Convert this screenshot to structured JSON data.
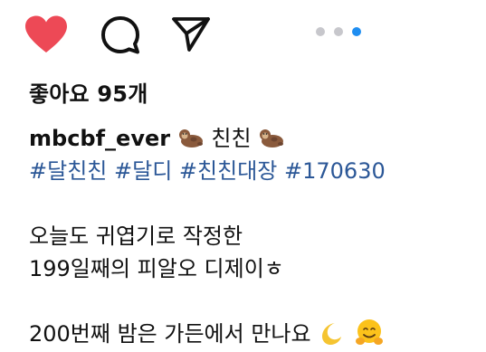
{
  "post": {
    "likes_text": "좋아요 95개",
    "username": "mbcbf_ever",
    "caption_head_text": "친친",
    "hashtags": [
      "#달친친",
      "#달디",
      "#친친대장",
      "#170630"
    ],
    "body_lines": [
      "오늘도 귀엽기로 작정한",
      "199일째의 피알오 디제이ㅎ"
    ],
    "last_line": "200번째 밤은 가든에서 만나요"
  },
  "icons": {
    "like": "heart-filled-icon",
    "comment": "comment-icon",
    "share": "send-icon",
    "carousel": "carousel-dots",
    "emoji_1": "otter-emoji",
    "emoji_2": "crescent-moon-emoji",
    "emoji_3": "hugging-face-emoji"
  },
  "carousel": {
    "total": 3,
    "active_index": 3
  },
  "colors": {
    "like_red": "#ed4956",
    "hashtag_blue": "#2b5797",
    "active_dot": "#1f8ef1",
    "inactive_dot": "#c7c7cc"
  }
}
